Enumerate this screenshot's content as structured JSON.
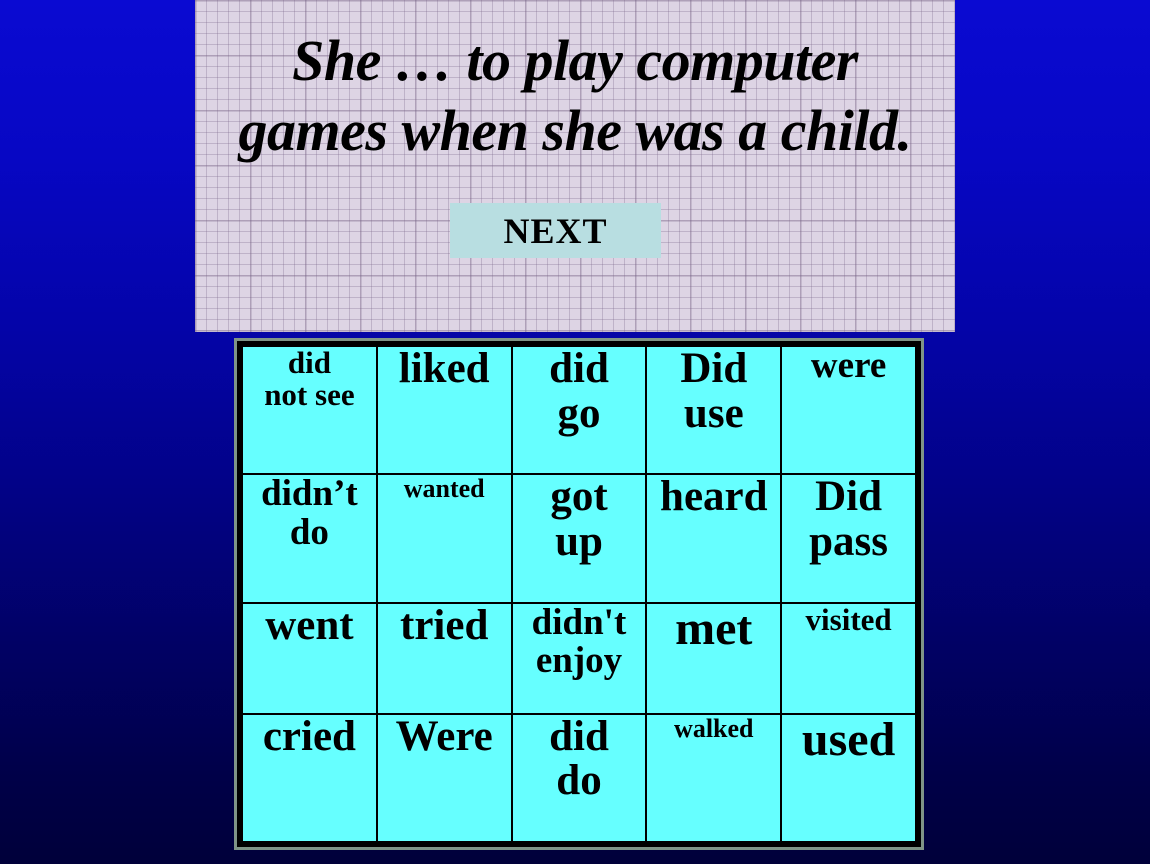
{
  "slide": {
    "background_top_color": "#0a0ad2",
    "background_bottom_color": "#00003a"
  },
  "header": {
    "panel_color": "#ddd4e4",
    "question": "She … to play computer games when she was a child."
  },
  "next_button": {
    "label": "NEXT",
    "color": "#b8dee1"
  },
  "grid": {
    "cell_color": "#66ffff",
    "border_color": "#000000",
    "frame_color": "#7f9487",
    "rows": 4,
    "columns": 5,
    "cells": [
      [
        {
          "text": "did\nnot see",
          "size": "sz-s",
          "align": "va-top"
        },
        {
          "text": "liked",
          "size": "sz-l",
          "align": "va-low"
        },
        {
          "text": "did\ngo",
          "size": "sz-l",
          "align": "va-top"
        },
        {
          "text": "Did\nuse",
          "size": "sz-l",
          "align": "va-top"
        },
        {
          "text": "were",
          "size": "sz-m",
          "align": "va-upper"
        }
      ],
      [
        {
          "text": "didn’t\ndo",
          "size": "sz-m",
          "align": "va-upper"
        },
        {
          "text": "wanted",
          "size": "sz-xs",
          "align": "va-upper"
        },
        {
          "text": "got\nup",
          "size": "sz-l",
          "align": "va-top"
        },
        {
          "text": "heard",
          "size": "sz-l",
          "align": "va-upper"
        },
        {
          "text": "Did\npass",
          "size": "sz-l",
          "align": "va-top"
        }
      ],
      [
        {
          "text": "went",
          "size": "sz-l",
          "align": "va-top"
        },
        {
          "text": "tried",
          "size": "sz-l",
          "align": "va-top"
        },
        {
          "text": "didn't\nenjoy",
          "size": "sz-m",
          "align": "va-top"
        },
        {
          "text": "met",
          "size": "sz-xl",
          "align": "va-top"
        },
        {
          "text": "visited",
          "size": "sz-s",
          "align": "va-top"
        }
      ],
      [
        {
          "text": "cried",
          "size": "sz-l",
          "align": "va-upper"
        },
        {
          "text": "Were",
          "size": "sz-l",
          "align": "va-upper"
        },
        {
          "text": "did\ndo",
          "size": "sz-l",
          "align": "va-upper"
        },
        {
          "text": "walked",
          "size": "sz-xs",
          "align": "va-upper"
        },
        {
          "text": "used",
          "size": "sz-xl",
          "align": "va-low"
        }
      ]
    ]
  }
}
